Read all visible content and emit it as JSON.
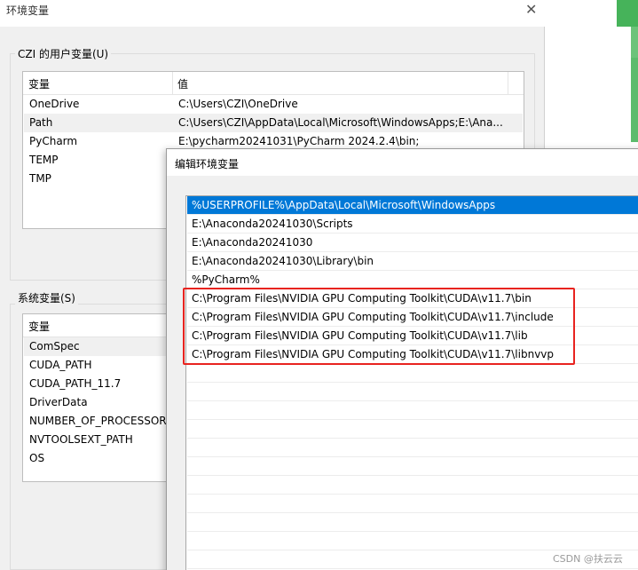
{
  "env_dialog": {
    "title": "环境变量",
    "close_label": "✕",
    "user_group_label": "CZI 的用户变量(U)",
    "user_columns": [
      "变量",
      "值"
    ],
    "user_rows": [
      {
        "name": "OneDrive",
        "value": "C:\\Users\\CZI\\OneDrive"
      },
      {
        "name": "Path",
        "value": "C:\\Users\\CZI\\AppData\\Local\\Microsoft\\WindowsApps;E:\\Ana..."
      },
      {
        "name": "PyCharm",
        "value": "E:\\pycharm20241031\\PyCharm 2024.2.4\\bin;"
      },
      {
        "name": "TEMP",
        "value": ""
      },
      {
        "name": "TMP",
        "value": ""
      }
    ],
    "system_group_label": "系统变量(S)",
    "system_columns": [
      "变量"
    ],
    "system_rows": [
      {
        "name": "ComSpec"
      },
      {
        "name": "CUDA_PATH"
      },
      {
        "name": "CUDA_PATH_11.7"
      },
      {
        "name": "DriverData"
      },
      {
        "name": "NUMBER_OF_PROCESSORS"
      },
      {
        "name": "NVTOOLSEXT_PATH"
      },
      {
        "name": "OS"
      }
    ]
  },
  "edit_dialog": {
    "title": "编辑环境变量",
    "entries": [
      "%USERPROFILE%\\AppData\\Local\\Microsoft\\WindowsApps",
      "E:\\Anaconda20241030\\Scripts",
      "E:\\Anaconda20241030",
      "E:\\Anaconda20241030\\Library\\bin",
      "%PyCharm%",
      "C:\\Program Files\\NVIDIA GPU Computing Toolkit\\CUDA\\v11.7\\bin",
      "C:\\Program Files\\NVIDIA GPU Computing Toolkit\\CUDA\\v11.7\\include",
      "C:\\Program Files\\NVIDIA GPU Computing Toolkit\\CUDA\\v11.7\\lib",
      "C:\\Program Files\\NVIDIA GPU Computing Toolkit\\CUDA\\v11.7\\libnvvp"
    ],
    "selected_index": 0
  },
  "watermark": "CSDN @扶云云",
  "colors": {
    "selection": "#0078d7",
    "highlight": "#e8231f",
    "accent_green": "#46b35a"
  }
}
